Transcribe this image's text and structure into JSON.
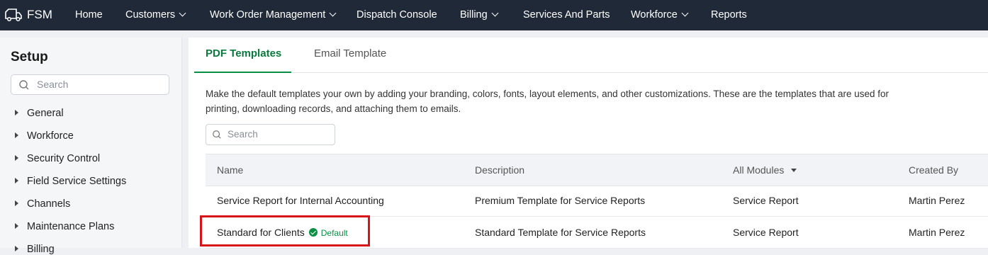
{
  "app": {
    "name": "FSM"
  },
  "nav": [
    {
      "label": "Home",
      "dropdown": false
    },
    {
      "label": "Customers",
      "dropdown": true
    },
    {
      "label": "Work Order Management",
      "dropdown": true
    },
    {
      "label": "Dispatch Console",
      "dropdown": false
    },
    {
      "label": "Billing",
      "dropdown": true
    },
    {
      "label": "Services And Parts",
      "dropdown": false
    },
    {
      "label": "Workforce",
      "dropdown": true
    },
    {
      "label": "Reports",
      "dropdown": false
    }
  ],
  "sidebar": {
    "title": "Setup",
    "search_placeholder": "Search",
    "items": [
      {
        "label": "General"
      },
      {
        "label": "Workforce"
      },
      {
        "label": "Security Control"
      },
      {
        "label": "Field Service Settings"
      },
      {
        "label": "Channels"
      },
      {
        "label": "Maintenance Plans"
      },
      {
        "label": "Billing"
      }
    ]
  },
  "main": {
    "tabs": [
      {
        "label": "PDF Templates",
        "active": true
      },
      {
        "label": "Email Template",
        "active": false
      }
    ],
    "description": "Make the default templates your own by adding your branding, colors, fonts, layout elements, and other customizations. These are the templates that are used for printing, downloading records, and attaching them to emails.",
    "search_placeholder": "Search",
    "table": {
      "columns": [
        "Name",
        "Description",
        "All Modules",
        "Created By"
      ],
      "rows": [
        {
          "name": "Service Report for Internal Accounting",
          "badge": "",
          "description": "Premium Template for Service Reports",
          "module": "Service Report",
          "created_by": "Martin Perez"
        },
        {
          "name": "Standard for Clients",
          "badge": "Default",
          "description": "Standard Template for Service Reports",
          "module": "Service Report",
          "created_by": "Martin Perez"
        }
      ]
    }
  },
  "colors": {
    "nav_bg": "#1f2937",
    "accent_green": "#0b8f45",
    "highlight_red": "#d8141b"
  }
}
